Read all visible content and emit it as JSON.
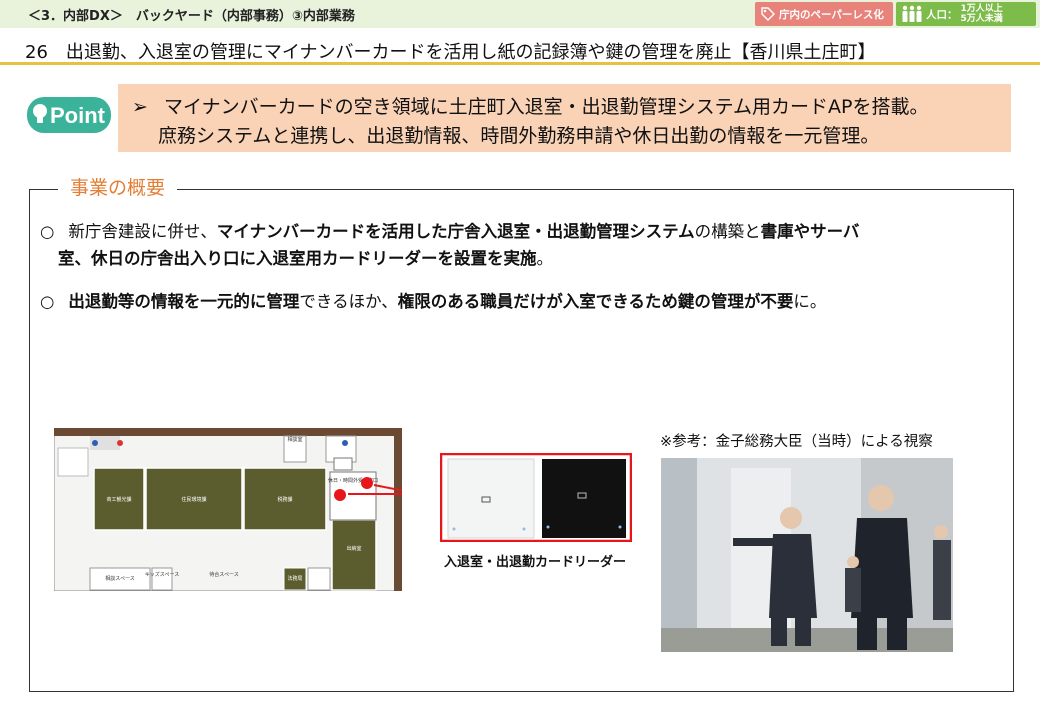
{
  "header": {
    "section": "＜3．内部DX＞　バックヤード（内部事務）③内部業務",
    "tag_paperless": "庁内のペーパーレス化",
    "population_label": "人口：",
    "population_line1": "1万人以上",
    "population_line2": "5万人未満"
  },
  "title": "26　出退勤、入退室の管理にマイナンバーカードを活用し紙の記録簿や鍵の管理を廃止【香川県土庄町】",
  "point": {
    "logo_text": "Point",
    "mark": "➢",
    "line1": "マイナンバーカードの空き領域に土庄町入退室・出退勤管理システム用カードAPを搭載。",
    "line2": "庶務システムと連携し、出退勤情報、時間外勤務申請や休日出勤の情報を一元管理。"
  },
  "overview": {
    "title": "事業の概要",
    "p1": {
      "bullet": "○",
      "s1": "新庁舎建設に併せ、",
      "s2": "マイナンバーカードを活用した庁舎入退室・出退勤管理システム",
      "s3": "の構築と",
      "s4": "書庫やサーバ",
      "s5": "室、休日の庁舎出入り口に入退室用カードリーダーを設置を実施",
      "s6": "。"
    },
    "p2": {
      "bullet": "○",
      "s1": "出退勤等の情報を一元的に管理",
      "s2": "できるほか、",
      "s3": "権限のある職員だけが入室できるため鍵の管理が不要",
      "s4": "に。"
    }
  },
  "floorplan": {
    "rooms": [
      "商工観光課",
      "住民環境課",
      "税務課",
      "出納室",
      "相談室",
      "待合スペース",
      "相談スペース",
      "キッズスペース",
      "法務局",
      "休日・時間外受付窓口"
    ]
  },
  "reader_caption": "入退室・出退勤カードリーダー",
  "reference_caption": "※参考：金子総務大臣（当時）による視察",
  "colors": {
    "accent_orange": "#e37e34",
    "point_bg": "#fad3b7",
    "rule_yellow": "#e5c33f",
    "tag_red": "#e8837c",
    "tag_green": "#7dbb4a",
    "topbar_bg": "#e9f3dc"
  }
}
